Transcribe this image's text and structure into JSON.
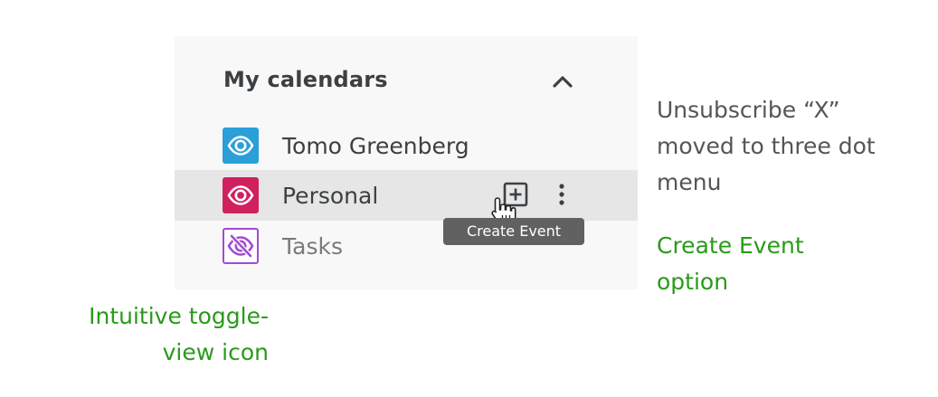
{
  "panel": {
    "title": "My calendars",
    "collapse_icon": "chevron-up-icon"
  },
  "calendars": [
    {
      "label": "Tomo Greenberg",
      "icon": "eye-icon",
      "color": "#2a9fd8",
      "visible": true
    },
    {
      "label": "Personal",
      "icon": "eye-icon",
      "color": "#d1205e",
      "visible": true,
      "hovered": true
    },
    {
      "label": "Tasks",
      "icon": "eye-off-icon",
      "color": "#a24bd1",
      "visible": false
    }
  ],
  "row_actions": {
    "add_icon": "add-box-icon",
    "more_icon": "more-vertical-icon"
  },
  "tooltip": {
    "text": "Create Event"
  },
  "annotations": {
    "unsubscribe": {
      "lines": [
        "Unsubscribe “X”",
        "moved to three dot",
        "menu"
      ],
      "color": "#555555"
    },
    "create_event": {
      "lines": [
        "Create Event",
        "option"
      ],
      "color": "#2a9a1a"
    },
    "toggle_view": {
      "lines": [
        "Intuitive toggle-",
        "view icon"
      ],
      "color": "#2a9a1a"
    }
  }
}
